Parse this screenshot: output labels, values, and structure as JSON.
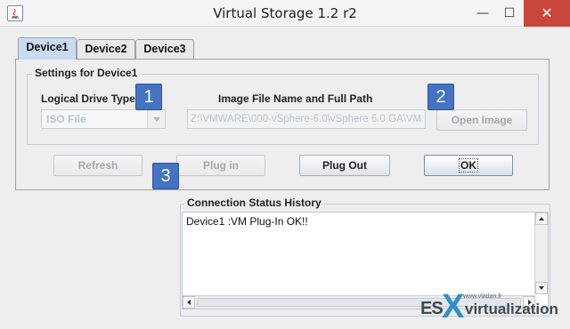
{
  "window": {
    "title": "Virtual Storage 1.2 r2",
    "minimize": "—",
    "maximize": "☐",
    "close": "✕"
  },
  "tabs": [
    {
      "label": "Device1",
      "active": true
    },
    {
      "label": "Device2",
      "active": false
    },
    {
      "label": "Device3",
      "active": false
    }
  ],
  "settings": {
    "group_title": "Settings for Device1",
    "drive_type_label": "Logical Drive Type",
    "drive_type_value": "ISO File",
    "image_path_label": "Image File Name and Full Path",
    "image_path_value": "Z:\\VMWARE\\000-vSphere-6.0\\vSphere 6.0 GA\\VM",
    "open_image_button": "Open Image"
  },
  "actions": {
    "refresh": "Refresh",
    "plug_in": "Plug in",
    "plug_out": "Plug Out",
    "ok": "OK"
  },
  "markers": [
    "1",
    "2",
    "3"
  ],
  "status": {
    "title": "Connection Status History",
    "lines": [
      "Device1 :VM Plug-In OK!!"
    ]
  },
  "watermark": {
    "small_text": "www.vladan.fr",
    "es": "ES",
    "x": "X",
    "rest": "virtualization"
  },
  "colors": {
    "marker_blue": "#4472c4",
    "active_tab": "#c8dbf0",
    "close_red": "#c9463d"
  }
}
